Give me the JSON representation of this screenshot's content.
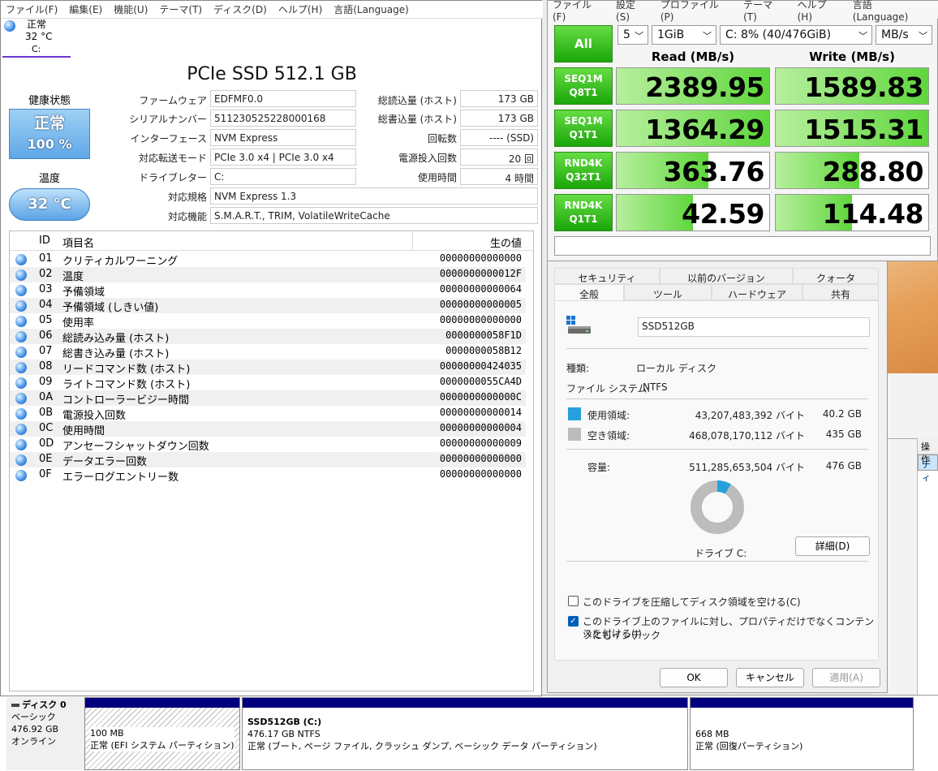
{
  "cdi": {
    "menu": [
      "ファイル(F)",
      "編集(E)",
      "機能(U)",
      "テーマ(T)",
      "ディスク(D)",
      "ヘルプ(H)",
      "言語(Language)"
    ],
    "tab": {
      "status": "正常",
      "temp": "32 °C",
      "drive": "C:"
    },
    "title": "PCIe SSD 512.1 GB",
    "health": {
      "label": "健康状態",
      "status": "正常",
      "percent": "100 %"
    },
    "temperature": {
      "label": "温度",
      "value": "32 °C"
    },
    "info": {
      "firmware_label": "ファームウェア",
      "firmware": "EDFMF0.0",
      "serial_label": "シリアルナンバー",
      "serial": "511230525228000168",
      "interface_label": "インターフェース",
      "interface": "NVM Express",
      "transfer_label": "対応転送モード",
      "transfer": "PCIe 3.0 x4 | PCIe 3.0 x4",
      "letter_label": "ドライブレター",
      "letter": "C:",
      "standard_label": "対応規格",
      "standard": "NVM Express 1.3",
      "features_label": "対応機能",
      "features": "S.M.A.R.T., TRIM, VolatileWriteCache",
      "reads_label": "総読込量 (ホスト)",
      "reads": "173 GB",
      "writes_label": "総書込量 (ホスト)",
      "writes": "173 GB",
      "rpm_label": "回転数",
      "rpm": "---- (SSD)",
      "power_count_label": "電源投入回数",
      "power_count": "20 回",
      "hours_label": "使用時間",
      "hours": "4 時間"
    },
    "smart_headers": {
      "id": "ID",
      "name": "項目名",
      "raw": "生の値"
    },
    "smart": [
      {
        "id": "01",
        "name": "クリティカルワーニング",
        "raw": "00000000000000"
      },
      {
        "id": "02",
        "name": "温度",
        "raw": "0000000000012F"
      },
      {
        "id": "03",
        "name": "予備領域",
        "raw": "00000000000064"
      },
      {
        "id": "04",
        "name": "予備領域 (しきい値)",
        "raw": "00000000000005"
      },
      {
        "id": "05",
        "name": "使用率",
        "raw": "00000000000000"
      },
      {
        "id": "06",
        "name": "総読み込み量 (ホスト)",
        "raw": "0000000058F1D"
      },
      {
        "id": "07",
        "name": "総書き込み量 (ホスト)",
        "raw": "0000000058B12"
      },
      {
        "id": "08",
        "name": "リードコマンド数 (ホスト)",
        "raw": "00000000424035"
      },
      {
        "id": "09",
        "name": "ライトコマンド数 (ホスト)",
        "raw": "0000000055CA4D"
      },
      {
        "id": "0A",
        "name": "コントローラービジー時間",
        "raw": "0000000000000C"
      },
      {
        "id": "0B",
        "name": "電源投入回数",
        "raw": "00000000000014"
      },
      {
        "id": "0C",
        "name": "使用時間",
        "raw": "00000000000004"
      },
      {
        "id": "0D",
        "name": "アンセーフシャットダウン回数",
        "raw": "00000000000009"
      },
      {
        "id": "0E",
        "name": "データエラー回数",
        "raw": "00000000000000"
      },
      {
        "id": "0F",
        "name": "エラーログエントリー数",
        "raw": "00000000000000"
      }
    ]
  },
  "cdm": {
    "menu": [
      "ファイル(F)",
      "設定(S)",
      "プロファイル(P)",
      "テーマ(T)",
      "ヘルプ(H)",
      "言語(Language)"
    ],
    "all_label": "All",
    "count": "5",
    "size": "1GiB",
    "drive": "C: 8% (40/476GiB)",
    "unit": "MB/s",
    "read_header": "Read (MB/s)",
    "write_header": "Write (MB/s)",
    "rows": [
      {
        "line1": "SEQ1M",
        "line2": "Q8T1",
        "read": "2389.95",
        "write": "1589.83",
        "read_fill": 1.0,
        "write_fill": 1.0
      },
      {
        "line1": "SEQ1M",
        "line2": "Q1T1",
        "read": "1364.29",
        "write": "1515.31",
        "read_fill": 1.0,
        "write_fill": 1.0
      },
      {
        "line1": "RND4K",
        "line2": "Q32T1",
        "read": "363.76",
        "write": "288.80",
        "read_fill": 0.6,
        "write_fill": 0.55
      },
      {
        "line1": "RND4K",
        "line2": "Q1T1",
        "read": "42.59",
        "write": "114.48",
        "read_fill": 0.5,
        "write_fill": 0.5
      }
    ]
  },
  "props": {
    "tabs_top": [
      "セキュリティ",
      "以前のバージョン",
      "クォータ"
    ],
    "tabs_bottom": [
      "全般",
      "ツール",
      "ハードウェア",
      "共有"
    ],
    "name": "SSD512GB",
    "type_label": "種類:",
    "type": "ローカル ディスク",
    "fs_label": "ファイル システム:",
    "fs": "NTFS",
    "used_label": "使用領域:",
    "used_bytes": "43,207,483,392 バイト",
    "used_gb": "40.2 GB",
    "free_label": "空き領域:",
    "free_bytes": "468,078,170,112 バイト",
    "free_gb": "435 GB",
    "cap_label": "容量:",
    "cap_bytes": "511,285,653,504 バイト",
    "cap_gb": "476 GB",
    "used_fraction": 0.085,
    "drive_label": "ドライブ C:",
    "details_button": "詳細(D)",
    "compress_label": "このドライブを圧縮してディスク領域を空ける(C)",
    "index_label_1": "このドライブ上のファイルに対し、プロパティだけでなくコンテンツにもインデック",
    "index_label_2": "スを付ける(I)",
    "ok": "OK",
    "cancel": "キャンセル",
    "apply": "適用(A)",
    "colors": {
      "used": "#26a0da",
      "free": "#bcbcbc"
    }
  },
  "diskmgmt": {
    "disk_name": "ディスク 0",
    "disk_type": "ベーシック",
    "disk_size": "476.92 GB",
    "disk_status": "オンライン",
    "p1_size": "100 MB",
    "p1_status": "正常 (EFI システム パーティション)",
    "p2_name": "SSD512GB (C:)",
    "p2_size": "476.17 GB NTFS",
    "p2_status": "正常 (ブート, ページ ファイル, クラッシュ ダンプ, ベーシック データ パーティション)",
    "p3_size": "668 MB",
    "p3_status": "正常 (回復パーティション)",
    "right_header": "操作",
    "right_item": "ディ"
  }
}
